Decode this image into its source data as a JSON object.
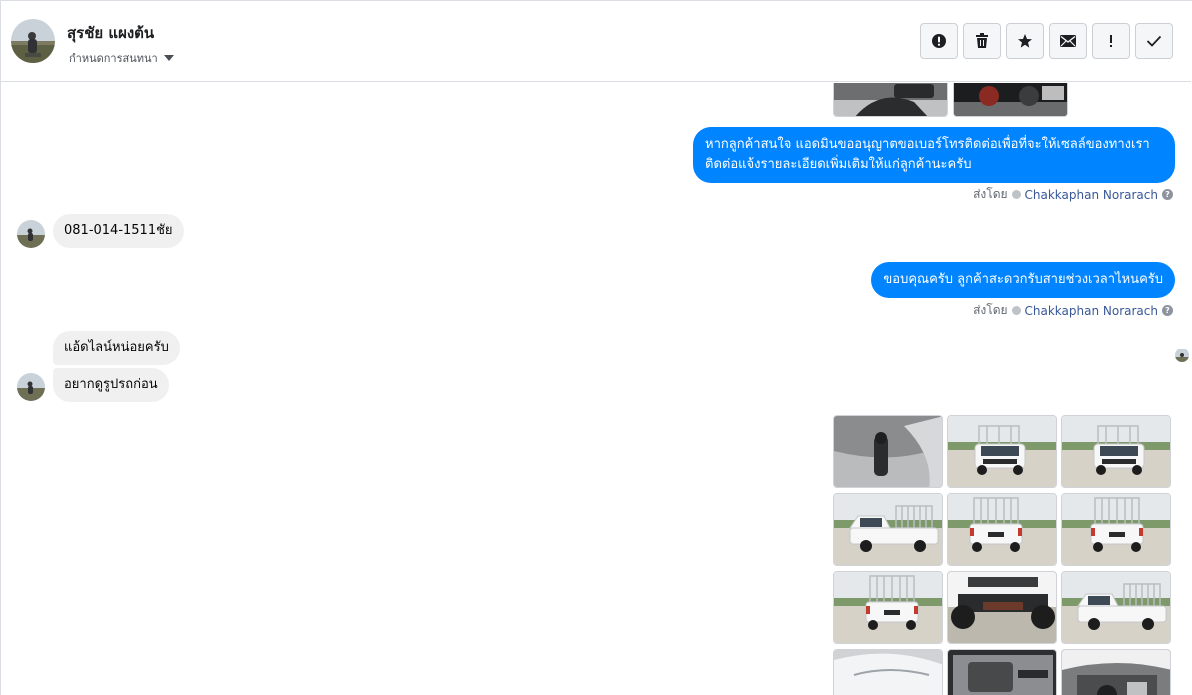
{
  "header": {
    "contact_name": "สุรชัย แผงต้น",
    "conversation_label": "กำหนดการสนทนา",
    "actions": [
      {
        "name": "report-icon",
        "label": "!"
      },
      {
        "name": "delete-icon",
        "label": "trash"
      },
      {
        "name": "star-icon",
        "label": "star"
      },
      {
        "name": "mail-icon",
        "label": "mail"
      },
      {
        "name": "important-icon",
        "label": "!"
      },
      {
        "name": "done-icon",
        "label": "check"
      }
    ]
  },
  "messages": {
    "out1_text": "หากลูกค้าสนใจ แอดมินขออนุญาตขอเบอร์โทรติดต่อเพื่อที่จะให้เซลล์ของทางเราติดต่อแจ้งรายละเอียดเพิ่มเติมให้แก่ลูกค้านะครับ",
    "sent_by_label": "ส่งโดย",
    "sender_name": "Chakkaphan Norarach",
    "in1_text": "081-014-1511ชัย",
    "out2_text": "ขอบคุณครับ ลูกค้าสะดวกรับสายช่วงเวลาไหนครับ",
    "in2_text": "แอ้ดไลน์หน่อยครับ",
    "in3_text": "อยากดูรูปรถก่อน"
  },
  "photo_grid": {
    "rows": 4,
    "cols": 3,
    "description_items": [
      "interior-gearshift",
      "truck-front-left",
      "truck-front",
      "truck-side-left",
      "truck-rear-left",
      "truck-rear",
      "truck-rear-right",
      "truck-underside",
      "truck-side-right",
      "truck-front-closeup",
      "truck-door-interior",
      "truck-engine"
    ]
  },
  "colors": {
    "outgoing_bubble": "#0084ff",
    "incoming_bubble": "#f1f0f0",
    "sender_link": "#385898",
    "border": "#dadde1"
  }
}
